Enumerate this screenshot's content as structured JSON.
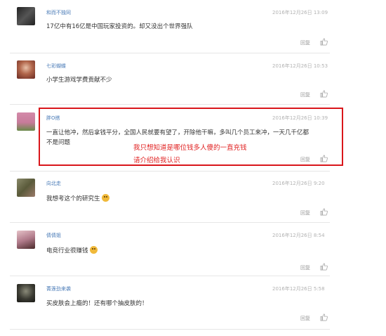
{
  "comments": [
    {
      "username": "和而不独同",
      "time": "2016年12月26日 13:09",
      "text": "17亿中有16亿是中国玩家投资的。却又没出个世界强队",
      "reply": "回复",
      "avatar_color": "#3a3a3a"
    },
    {
      "username": "七彩蝴蝶",
      "time": "2016年12月26日 10:53",
      "text": "小学生游戏学费贡献不少",
      "reply": "回复",
      "avatar_color": "#9c5a4a"
    },
    {
      "username": "胖O搭",
      "time": "2016年12月26日 10:39",
      "text_line1": "一直让他冲，然后拿钱平分，全国人民就要有望了，开除他干嘛，多叫几个员工来冲，一天几千亿都",
      "text_line2": "不是问题",
      "reply": "回复",
      "avatar_color": "#c77b9a"
    },
    {
      "username": "向北走",
      "time": "2016年12月26日 9:20",
      "text": "我想考这个的研究生",
      "reply": "回复",
      "avatar_color": "#6b6b4a"
    },
    {
      "username": "倩倩姐",
      "time": "2016年12月26日 8:54",
      "text": "电竞行业很赚钱",
      "reply": "回复",
      "avatar_color": "#b07a8a"
    },
    {
      "username": "菁莲劲来袭",
      "time": "2016年12月26日 5:58",
      "text": "买皮肤会上瘾的！还有哪个抽皮肤的！",
      "reply": "回复",
      "avatar_color": "#2e2e28"
    }
  ],
  "annotation": {
    "line1": "我只想知道是哪位钱多人傻的一直充钱",
    "line2": "请介绍给我认识",
    "color": "#e02020",
    "box_color": "#d9161b"
  },
  "like_icon": "thumbs-up-icon"
}
